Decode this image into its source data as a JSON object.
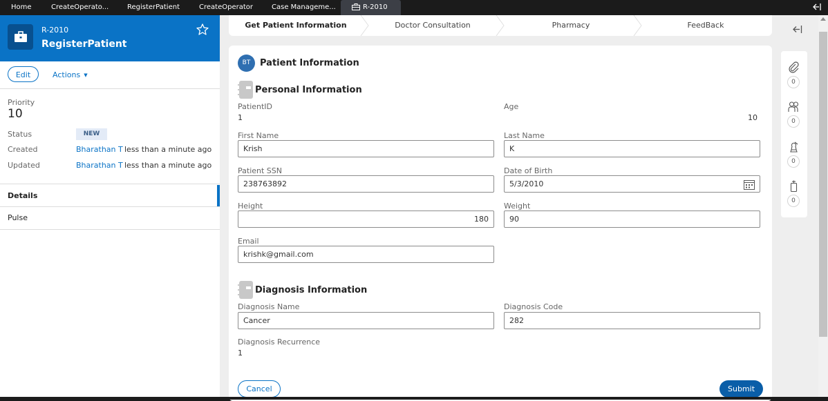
{
  "top_tabs": [
    {
      "label": "Home"
    },
    {
      "label": "CreateOperato..."
    },
    {
      "label": "RegisterPatient"
    },
    {
      "label": "CreateOperator"
    },
    {
      "label": "Case Manageme..."
    },
    {
      "label": "R-2010",
      "active": true,
      "icon": "briefcase-icon"
    }
  ],
  "case": {
    "id": "R-2010",
    "name": "RegisterPatient",
    "icon": "briefcase-icon",
    "favorite_icon": "star-outline-icon"
  },
  "case_actions": {
    "edit_label": "Edit",
    "actions_label": "Actions"
  },
  "summary": {
    "priority_label": "Priority",
    "priority_value": "10",
    "status_label": "Status",
    "status_value": "NEW",
    "created_label": "Created",
    "created_by": "Bharathan T",
    "created_when": "less than a minute ago",
    "updated_label": "Updated",
    "updated_by": "Bharathan T",
    "updated_when": "less than a minute ago"
  },
  "left_nav": {
    "details": "Details",
    "pulse": "Pulse"
  },
  "stages": [
    {
      "label": "Get Patient Information",
      "current": true
    },
    {
      "label": "Doctor Consultation"
    },
    {
      "label": "Pharmacy"
    },
    {
      "label": "FeedBack"
    }
  ],
  "form": {
    "avatar_initials": "BT",
    "title": "Patient Information",
    "personal_section": "Personal Information",
    "patient_id_label": "PatientID",
    "patient_id_value": "1",
    "age_label": "Age",
    "age_value": "10",
    "first_name_label": "First Name",
    "first_name_value": "Krish",
    "last_name_label": "Last Name",
    "last_name_value": "K",
    "ssn_label": "Patient SSN",
    "ssn_value": "238763892",
    "dob_label": "Date of Birth",
    "dob_value": "5/3/2010",
    "height_label": "Height",
    "height_value": "180",
    "weight_label": "Weight",
    "weight_value": "90",
    "email_label": "Email",
    "email_value": "krishk@gmail.com",
    "diagnosis_section": "Diagnosis Information",
    "diagnosis_name_label": "Diagnosis Name",
    "diagnosis_name_value": "Cancer",
    "diagnosis_code_label": "Diagnosis Code",
    "diagnosis_code_value": "282",
    "diagnosis_recurrence_label": "Diagnosis Recurrence",
    "diagnosis_recurrence_value": "1",
    "cancel_label": "Cancel",
    "submit_label": "Submit"
  },
  "utilities": [
    {
      "icon": "paperclip-icon",
      "count": "0"
    },
    {
      "icon": "followers-icon",
      "count": "0"
    },
    {
      "icon": "stakeholder-icon",
      "count": "0"
    },
    {
      "icon": "related-cases-icon",
      "count": "0"
    }
  ],
  "colors": {
    "brand_blue": "#0a73c6",
    "topbar": "#1b1b1b",
    "status_badge_bg": "#e3ebf7",
    "submit_bg": "#0a5ea8"
  }
}
